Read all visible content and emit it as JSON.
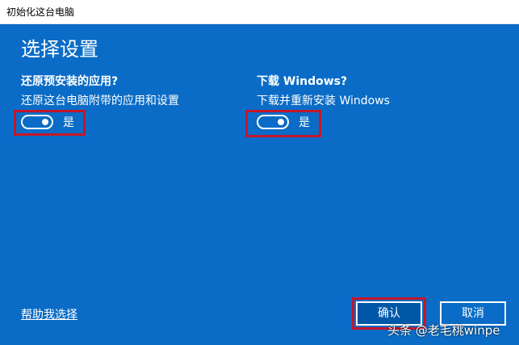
{
  "window": {
    "title": "初始化这台电脑"
  },
  "main": {
    "heading": "选择设置",
    "left_option": {
      "question": "还原预安装的应用?",
      "description": "还原这台电脑附带的应用和设置",
      "toggle_label": "是",
      "toggle_on": true
    },
    "right_option": {
      "question": "下载 Windows?",
      "description": "下载并重新安装 Windows",
      "toggle_label": "是",
      "toggle_on": true
    },
    "help_link": "帮助我选择",
    "buttons": {
      "confirm": "确认",
      "cancel": "取消"
    }
  },
  "overlay": {
    "watermark": "头条 @老毛桃winpe"
  },
  "colors": {
    "panel_bg": "#0a6cc6",
    "highlight": "#c4162a",
    "primary_button": "#0057a8"
  }
}
